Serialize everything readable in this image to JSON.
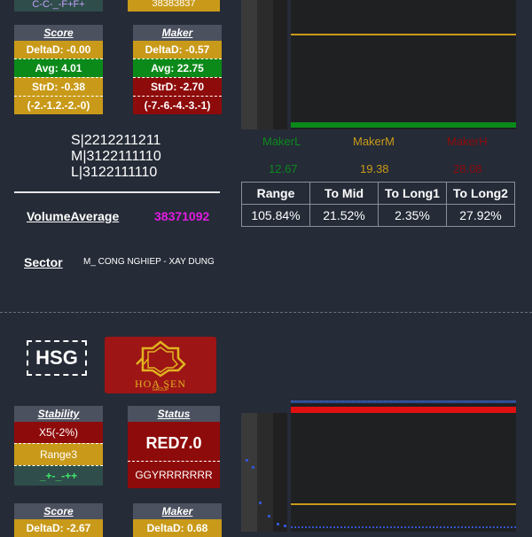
{
  "top_fragments": {
    "left_card_row": "C-C-_-F+F+",
    "right_card_row": "38383837"
  },
  "score1": {
    "title": "Score",
    "delta": "DeltaD: -0.00",
    "avg": "Avg: 4.01",
    "str": "StrD: -0.38",
    "seq": "(-2.-1.2.-2.-0)"
  },
  "maker1": {
    "title": "Maker",
    "delta": "DeltaD: -0.57",
    "avg": "Avg: 22.75",
    "str": "StrD: -2.70",
    "seq": "(-7.-6.-4.-3.-1)"
  },
  "slm": {
    "s": "S|2212211211",
    "m": "M|3122111110",
    "l": "L|3122111110"
  },
  "volume": {
    "label": "VolumeAverage",
    "value": "38371092"
  },
  "sector": {
    "label": "Sector",
    "value": "M_ CONG NGHIEP - XAY DUNG"
  },
  "makers": [
    {
      "name": "MakerL",
      "value": "12.67",
      "color": "#0c8a1c"
    },
    {
      "name": "MakerM",
      "value": "19.38",
      "color": "#c99a19"
    },
    {
      "name": "MakerH",
      "value": "28.08",
      "color": "#8e0b0b"
    }
  ],
  "stats": {
    "headers": [
      "Range",
      "To Mid",
      "To Long1",
      "To Long2"
    ],
    "values": [
      "105.84%",
      "21.52%",
      "2.35%",
      "27.92%"
    ]
  },
  "ticker2": {
    "symbol": "HSG",
    "logo_text": "HOA SEN",
    "logo_sub": "GROUP"
  },
  "stability": {
    "title": "Stability",
    "x": "X5(-2%)",
    "range": "Range3",
    "signs": "_+-_-++"
  },
  "status": {
    "title": "Status",
    "value": "RED7.0",
    "code": "GGYRRRRRRR"
  },
  "score2": {
    "title": "Score",
    "delta": "DeltaD: -2.67"
  },
  "maker2": {
    "title": "Maker",
    "delta": "DeltaD: 0.68"
  },
  "colors": {
    "background": "#252b37",
    "gold": "#c99a19",
    "green": "#0b8a1a",
    "red": "#8e0b0b",
    "magenta": "#e21ce0",
    "chart_red": "#e01010"
  }
}
